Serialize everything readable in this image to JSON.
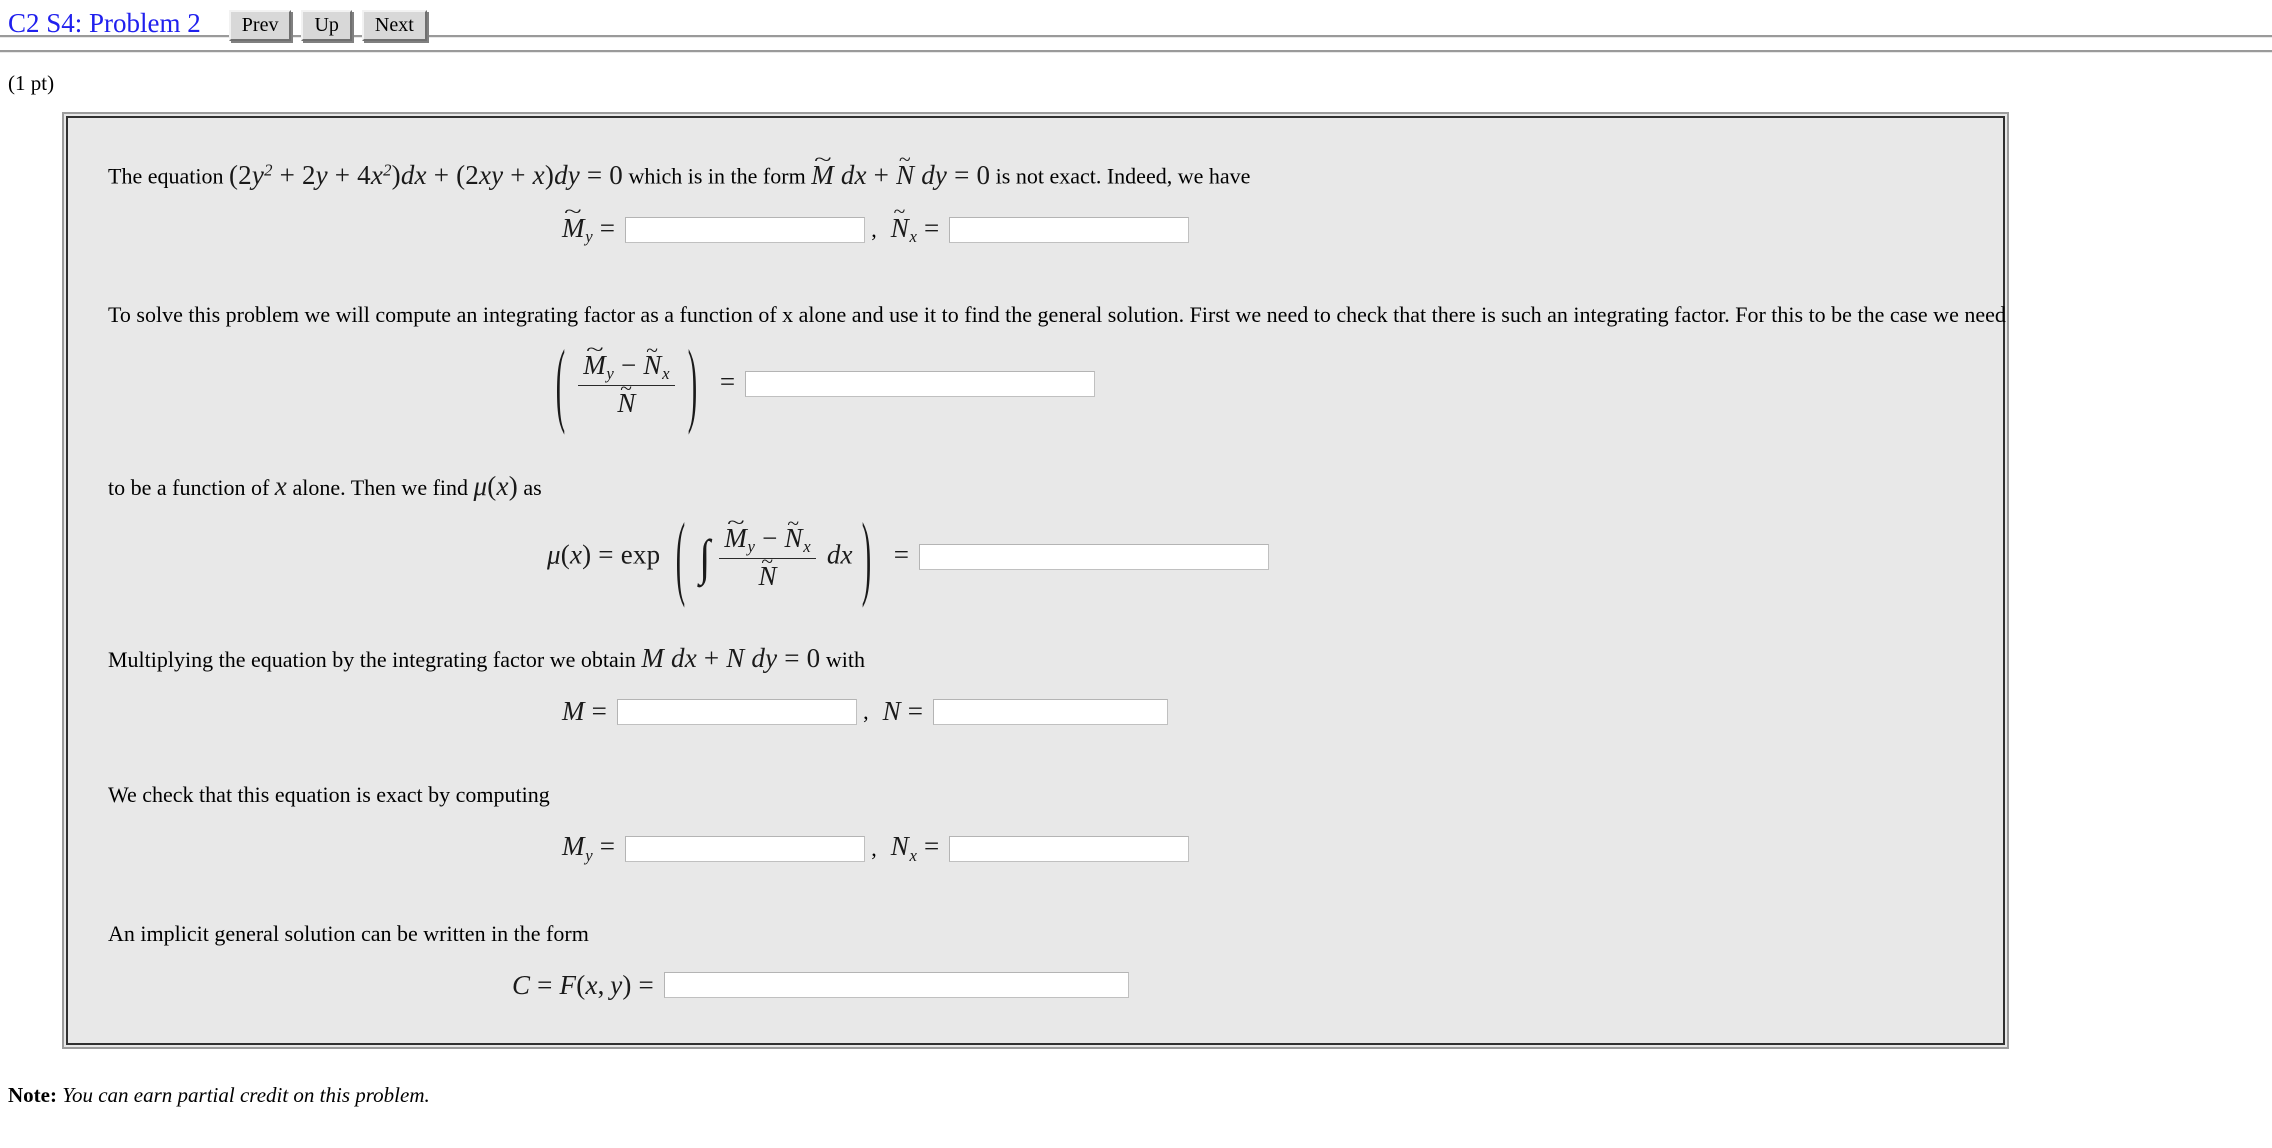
{
  "header": {
    "title": "C2 S4: Problem 2",
    "buttons": [
      {
        "label": "Prev",
        "name": "prev-button"
      },
      {
        "label": "Up",
        "name": "up-button"
      },
      {
        "label": "Next",
        "name": "next-button"
      }
    ]
  },
  "points": "(1 pt)",
  "problem": {
    "intro": {
      "text_before": "The equation",
      "equation": "(2y² + 2y + 4x²)dx + (2xy + x)dy = 0",
      "text_middle": "which is in the form",
      "form": "M̃ dx + Ñ dy = 0",
      "text_after": "is not exact. Indeed, we have"
    },
    "row1": {
      "label_left": "M̃_y =",
      "comma": ",",
      "label_right": "Ñ_x =",
      "value_left": "",
      "value_right": ""
    },
    "para2": "To solve this problem we will compute an integrating factor as a function of x alone and use it to find the general solution. First we need to check that there is such an integrating factor. For this to be the case we need",
    "row2": {
      "expression": "( (M̃_y − Ñ_x) / Ñ ) =",
      "value": ""
    },
    "para3": "to be a function of x alone. Then we find μ(x) as",
    "row3": {
      "expression": "μ(x) = exp ( ∫ (M̃_y − Ñ_x)/Ñ dx ) =",
      "value": ""
    },
    "para4": {
      "text_before": "Multiplying the equation by the integrating factor we obtain",
      "equation": "M dx + N dy = 0",
      "text_after": "with"
    },
    "row4": {
      "label_left": "M =",
      "comma": ",",
      "label_right": "N =",
      "value_left": "",
      "value_right": ""
    },
    "para5": "We check that this equation is exact by computing",
    "row5": {
      "label_left": "M_y =",
      "comma": ",",
      "label_right": "N_x =",
      "value_left": "",
      "value_right": ""
    },
    "para6": "An implicit general solution can be written in the form",
    "row6": {
      "label": "C = F(x, y) =",
      "value": ""
    }
  },
  "note": {
    "bold": "Note:",
    "italic": "You can earn partial credit on this problem."
  },
  "colors": {
    "title": "#2020ee",
    "panel_bg": "#e8e8e8",
    "panel_border_outer": "#9c9c9c",
    "panel_border_inner": "#303030",
    "input_bg": "#ffffff"
  }
}
